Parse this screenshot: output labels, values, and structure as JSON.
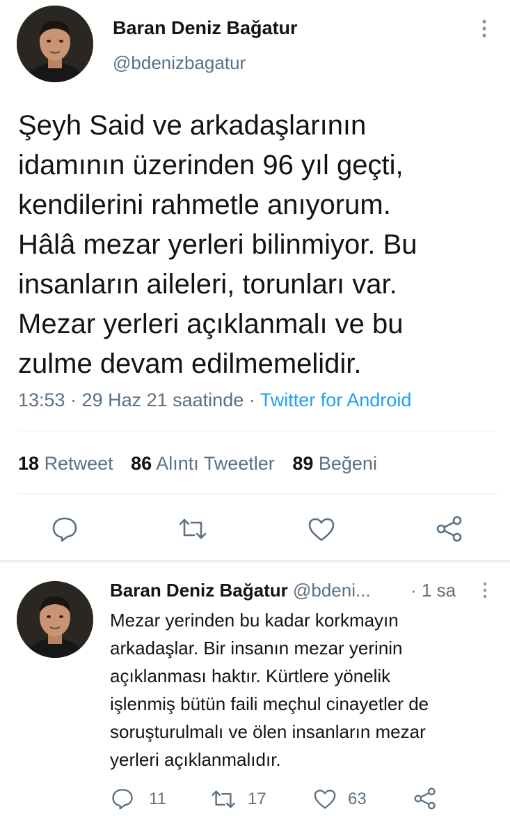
{
  "main_tweet": {
    "author_name": "Baran Deniz Bağatur",
    "author_handle": "@bdenizbagatur",
    "text_lines": [
      "Şeyh Said ve arkadaşlarının",
      "idamının üzerinden 96 yıl geçti,",
      "kendilerini rahmetle anıyorum.",
      "Hâlâ mezar yerleri bilinmiyor. Bu",
      "insanların aileleri, torunları var.",
      "Mezar yerleri açıklanmalı ve bu",
      "zulme devam edilmemelidir."
    ],
    "timestamp": "13:53 · 29 Haz 21 saatinde · ",
    "source": "Twitter for Android",
    "stats": {
      "retweets": "18",
      "retweets_label": "Retweet",
      "quotes": "86",
      "quotes_label": "Alıntı Tweetler",
      "likes": "89",
      "likes_label": "Beğeni"
    }
  },
  "reply_tweet": {
    "author_name": "Baran Deniz Bağatur",
    "author_handle": "@bdeni...",
    "time": "· 1 sa",
    "text_lines": [
      "Mezar yerinden bu kadar korkmayın",
      "arkadaşlar. Bir insanın mezar yerinin",
      "açıklanması haktır. Kürtlere yönelik",
      "işlenmiş bütün faili meçhul cinayetler de",
      "soruşturulmalı ve ölen insanların mezar",
      "yerleri açıklanmalıdır."
    ],
    "reply_count": "11",
    "retweet_count": "17",
    "like_count": "63"
  },
  "icons": {
    "reply": "reply-icon",
    "retweet": "retweet-icon",
    "like": "heart-icon",
    "share": "share-icon",
    "more": "more-vertical-icon"
  },
  "colors": {
    "accent": "#1da1f2",
    "secondary_text": "#5b7083",
    "divider": "#e6ecf0"
  }
}
